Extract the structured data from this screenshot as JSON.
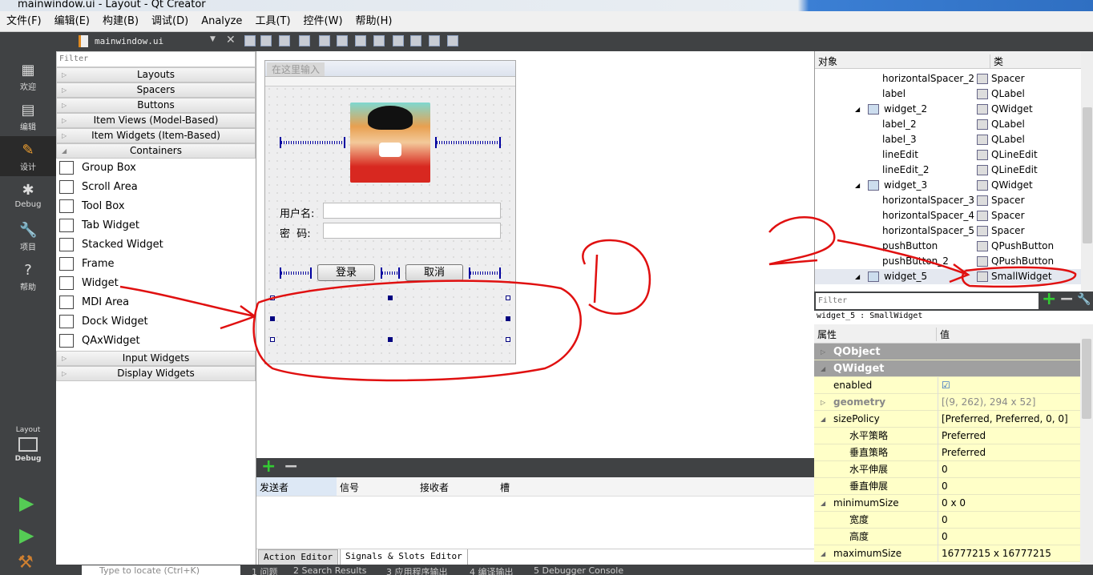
{
  "window": {
    "title": "mainwindow.ui - Layout - Qt Creator"
  },
  "menu": [
    "文件(F)",
    "编辑(E)",
    "构建(B)",
    "调试(D)",
    "Analyze",
    "工具(T)",
    "控件(W)",
    "帮助(H)"
  ],
  "toolbar": {
    "file": "mainwindow.ui"
  },
  "modes": [
    {
      "label": "欢迎",
      "icon": "grid-icon"
    },
    {
      "label": "编辑",
      "icon": "edit-icon"
    },
    {
      "label": "设计",
      "icon": "pencil-icon"
    },
    {
      "label": "Debug",
      "icon": "bug-icon"
    },
    {
      "label": "项目",
      "icon": "wrench-icon"
    },
    {
      "label": "帮助",
      "icon": "help-icon"
    }
  ],
  "kit": {
    "label": "Layout",
    "sub": "Debug"
  },
  "widgetbox": {
    "filter_placeholder": "Filter",
    "categories_top": [
      "Layouts",
      "Spacers",
      "Buttons",
      "Item Views (Model-Based)",
      "Item Widgets (Item-Based)",
      "Containers"
    ],
    "containers": [
      "Group Box",
      "Scroll Area",
      "Tool Box",
      "Tab Widget",
      "Stacked Widget",
      "Frame",
      "Widget",
      "MDI Area",
      "Dock Widget",
      "QAxWidget"
    ],
    "categories_bottom": [
      "Input Widgets",
      "Display Widgets"
    ]
  },
  "form": {
    "menu_placeholder": "在这里输入",
    "user_label": "用户名:",
    "pass_label": "密  码:",
    "login": "登录",
    "cancel": "取消"
  },
  "signals": {
    "columns": [
      "发送者",
      "信号",
      "接收者",
      "槽"
    ],
    "tabs": [
      "Action Editor",
      "Signals & Slots Editor"
    ]
  },
  "status": {
    "locate_placeholder": "Type to locate (Ctrl+K)",
    "panes": [
      "1 问题",
      "2 Search Results",
      "3 应用程序输出",
      "4 编译输出",
      "5 Debugger Console"
    ]
  },
  "objinsp": {
    "col_object": "对象",
    "col_class": "类",
    "rows": [
      {
        "name": "horizontalSpacer_2",
        "cls": "Spacer",
        "indent": 2
      },
      {
        "name": "label",
        "cls": "QLabel",
        "indent": 2
      },
      {
        "name": "widget_2",
        "cls": "QWidget",
        "indent": 1
      },
      {
        "name": "label_2",
        "cls": "QLabel",
        "indent": 2
      },
      {
        "name": "label_3",
        "cls": "QLabel",
        "indent": 2
      },
      {
        "name": "lineEdit",
        "cls": "QLineEdit",
        "indent": 2
      },
      {
        "name": "lineEdit_2",
        "cls": "QLineEdit",
        "indent": 2
      },
      {
        "name": "widget_3",
        "cls": "QWidget",
        "indent": 1
      },
      {
        "name": "horizontalSpacer_3",
        "cls": "Spacer",
        "indent": 2
      },
      {
        "name": "horizontalSpacer_4",
        "cls": "Spacer",
        "indent": 2
      },
      {
        "name": "horizontalSpacer_5",
        "cls": "Spacer",
        "indent": 2
      },
      {
        "name": "pushButton",
        "cls": "QPushButton",
        "indent": 2
      },
      {
        "name": "pushButton_2",
        "cls": "QPushButton",
        "indent": 2
      },
      {
        "name": "widget_5",
        "cls": "SmallWidget",
        "indent": 1
      }
    ]
  },
  "propeditor": {
    "filter_placeholder": "Filter",
    "selected": "widget_5 : SmallWidget",
    "col_prop": "属性",
    "col_value": "值",
    "rows": [
      {
        "k": "QObject",
        "v": "",
        "sec": true
      },
      {
        "k": "QWidget",
        "v": "",
        "sec": true
      },
      {
        "k": "enabled",
        "v": "☑",
        "lvl": 0
      },
      {
        "k": "geometry",
        "v": "[(9, 262), 294 x 52]",
        "lvl": 0,
        "dim": true
      },
      {
        "k": "sizePolicy",
        "v": "[Preferred, Preferred, 0, 0]",
        "lvl": 0
      },
      {
        "k": "水平策略",
        "v": "Preferred",
        "lvl": 1
      },
      {
        "k": "垂直策略",
        "v": "Preferred",
        "lvl": 1
      },
      {
        "k": "水平伸展",
        "v": "0",
        "lvl": 1
      },
      {
        "k": "垂直伸展",
        "v": "0",
        "lvl": 1
      },
      {
        "k": "minimumSize",
        "v": "0 x 0",
        "lvl": 0
      },
      {
        "k": "宽度",
        "v": "0",
        "lvl": 1
      },
      {
        "k": "高度",
        "v": "0",
        "lvl": 1
      },
      {
        "k": "maximumSize",
        "v": "16777215 x 16777215",
        "lvl": 0
      }
    ]
  },
  "annotations": {
    "color": "#e01010",
    "labels": [
      "①",
      "②"
    ]
  },
  "colors": {
    "dark": "#404244",
    "prop_bg": "#ffffc8",
    "section": "#a0a0a0",
    "spacer": "#0000a0"
  }
}
